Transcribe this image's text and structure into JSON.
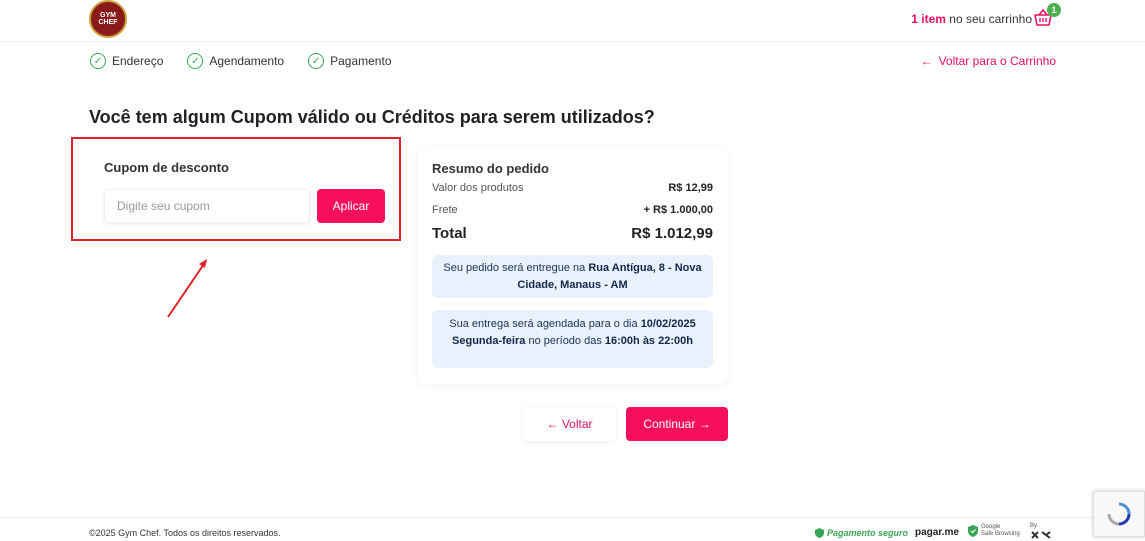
{
  "header": {
    "logo_text": "GYM CHEF",
    "cart_count": "1 item",
    "cart_suffix": " no seu carrinho",
    "cart_badge": "1"
  },
  "steps": [
    {
      "label": "Endereço"
    },
    {
      "label": "Agendamento"
    },
    {
      "label": "Pagamento"
    }
  ],
  "back_to_cart": "Voltar para o Carrinho",
  "page_title": "Você tem algum Cupom válido ou Créditos para serem utilizados?",
  "coupon": {
    "label": "Cupom de desconto",
    "placeholder": "Digite seu cupom",
    "apply_label": "Aplicar"
  },
  "summary": {
    "title": "Resumo do pedido",
    "products_label": "Valor dos produtos",
    "products_value": "R$ 12,99",
    "shipping_label": "Frete",
    "shipping_value": "+ R$ 1.000,00",
    "total_label": "Total",
    "total_value": "R$ 1.012,99",
    "delivery_prefix": "Seu pedido será entregue na ",
    "delivery_address": "Rua Antígua, 8 - Nova Cidade, Manaus - AM",
    "schedule_prefix": "Sua entrega será agendada para o dia ",
    "schedule_date": "10/02/2025 Segunda-feira",
    "schedule_mid": " no período das ",
    "schedule_time": "16:00h às 22:00h"
  },
  "nav": {
    "back_label": "Voltar",
    "continue_label": "Continuar"
  },
  "footer": {
    "copyright": "©2025 Gym Chef. Todos os direitos reservados.",
    "secure": "Pagamento seguro",
    "pagarme": "pagar.me",
    "google_line1": "Google",
    "google_line2": "Safe Browsing",
    "by": "By"
  },
  "colors": {
    "accent": "#f50f5c",
    "success": "#3aa655",
    "highlight": "#e0202a",
    "info_bg": "#e9f2fc"
  }
}
